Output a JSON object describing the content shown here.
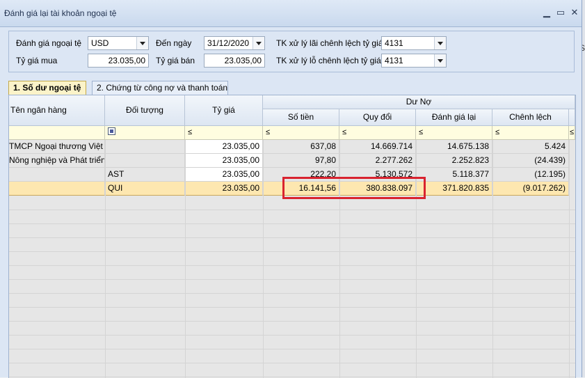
{
  "window": {
    "title": "Đánh giá lại tài khoản ngoại tệ"
  },
  "background": {
    "edge_letter": "S"
  },
  "form": {
    "currency_label": "Đánh giá ngoại tệ",
    "currency_value": "USD",
    "date_label": "Đến ngày",
    "date_value": "31/12/2020",
    "gain_account_label": "TK xử lý lãi chênh lệch tỷ giá",
    "gain_account_value": "4131",
    "buy_rate_label": "Tỷ giá mua",
    "buy_rate_value": "23.035,00",
    "sell_rate_label": "Tỷ giá bán",
    "sell_rate_value": "23.035,00",
    "loss_account_label": "TK xử lý lỗ chênh lệch tỷ giá",
    "loss_account_value": "4131"
  },
  "tabs": [
    {
      "label": "1. Số dư ngoại tệ"
    },
    {
      "label": "2. Chứng từ công nợ và thanh toán"
    }
  ],
  "grid": {
    "group_header": "Dư Nợ",
    "columns": {
      "bank": "Tên ngân hàng",
      "object": "Đối tượng",
      "rate": "Tỷ giá",
      "amount": "Số tiền",
      "converted": "Quy đổi",
      "revalued": "Đánh giá lại",
      "difference": "Chênh lệch"
    },
    "filter_symbol": "≤",
    "rows": [
      {
        "bank": "TMCP Ngoại thương Việt",
        "object": "",
        "rate": "23.035,00",
        "amount": "637,08",
        "converted": "14.669.714",
        "revalued": "14.675.138",
        "difference": "5.424"
      },
      {
        "bank": "Nông nghiệp và Phát triển",
        "object": "",
        "rate": "23.035,00",
        "amount": "97,80",
        "converted": "2.277.262",
        "revalued": "2.252.823",
        "difference": "(24.439)"
      },
      {
        "bank": "",
        "object": "AST",
        "rate": "23.035,00",
        "amount": "222,20",
        "converted": "5.130.572",
        "revalued": "5.118.377",
        "difference": "(12.195)"
      },
      {
        "bank": "",
        "object": "QUI",
        "rate": "23.035,00",
        "amount": "16.141,56",
        "converted": "380.838.097",
        "revalued": "371.820.835",
        "difference": "(9.017.262)"
      }
    ]
  }
}
